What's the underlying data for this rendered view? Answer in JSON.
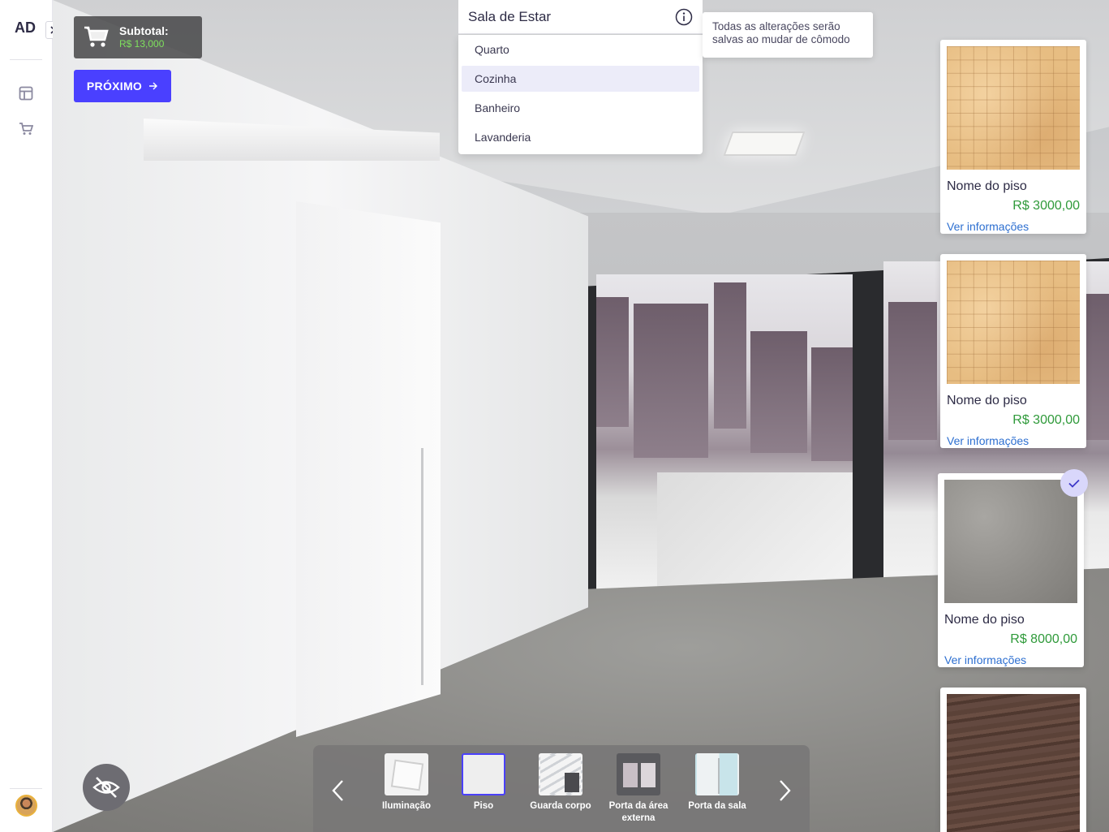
{
  "sidebar": {
    "logo": "AD"
  },
  "cart": {
    "label": "Subtotal:",
    "value": "R$ 13,000"
  },
  "next_button": {
    "label": "PRÓXIMO"
  },
  "room_select": {
    "selected": "Sala de Estar",
    "options": [
      "Quarto",
      "Cozinha",
      "Banheiro",
      "Lavanderia"
    ],
    "highlighted": "Cozinha"
  },
  "save_tip": {
    "text": "Todas as alterações serão salvas ao mudar de cômodo"
  },
  "products": [
    {
      "name": "Nome do piso",
      "price": "R$ 3000,00",
      "info": "Ver informações",
      "texture": "tile",
      "selected": false
    },
    {
      "name": "Nome do piso",
      "price": "R$ 3000,00",
      "info": "Ver informações",
      "texture": "tile",
      "selected": false
    },
    {
      "name": "Nome do piso",
      "price": "R$ 8000,00",
      "info": "Ver informações",
      "texture": "stone",
      "selected": true
    },
    {
      "name": "",
      "price": "",
      "info": "",
      "texture": "wood",
      "selected": false
    }
  ],
  "categories": [
    {
      "label": "Iluminação",
      "icon": "ceiling-light-thumb",
      "active": false
    },
    {
      "label": "Piso",
      "icon": "wood-floor-thumb",
      "active": true
    },
    {
      "label": "Guarda corpo",
      "icon": "glass-railing-thumb",
      "active": false
    },
    {
      "label": "Porta da área externa",
      "icon": "balcony-door-thumb",
      "active": false
    },
    {
      "label": "Porta da sala",
      "icon": "room-door-thumb",
      "active": false
    }
  ],
  "colors": {
    "accent": "#4a40ff",
    "price": "#2f9a3a",
    "subtotal_value": "#7ee05d",
    "link": "#2d6fd0"
  }
}
